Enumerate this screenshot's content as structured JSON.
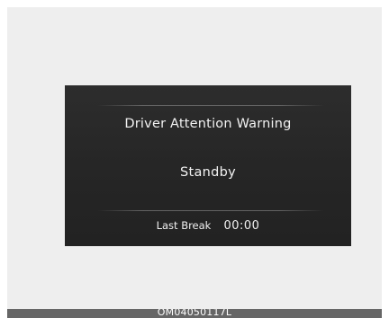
{
  "display": {
    "title": "Driver Attention Warning",
    "status": "Standby",
    "last_break_label": "Last Break",
    "last_break_time": "00:00"
  },
  "footer": {
    "code": "OM04050117L"
  }
}
